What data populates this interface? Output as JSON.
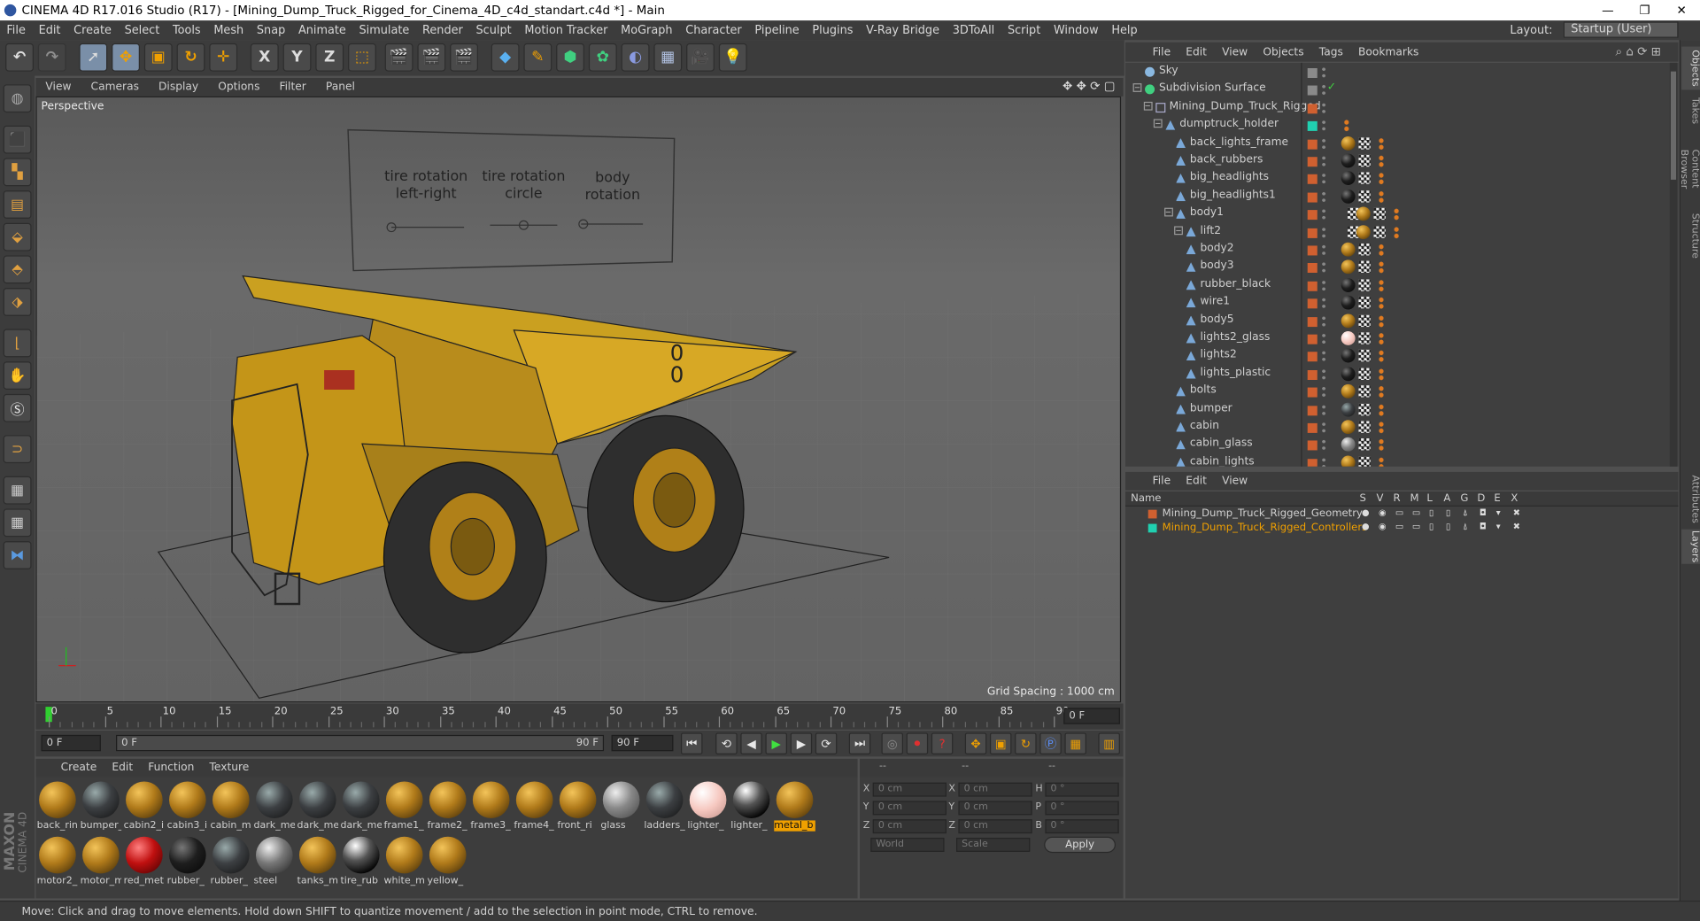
{
  "window": {
    "title": "CINEMA 4D R17.016 Studio (R17) - [Mining_Dump_Truck_Rigged_for_Cinema_4D_c4d_standart.c4d *] - Main",
    "controls": [
      "—",
      "❐",
      "✕"
    ]
  },
  "menu": [
    "File",
    "Edit",
    "Create",
    "Select",
    "Tools",
    "Mesh",
    "Snap",
    "Animate",
    "Simulate",
    "Render",
    "Sculpt",
    "Motion Tracker",
    "MoGraph",
    "Character",
    "Pipeline",
    "Plugins",
    "V-Ray Bridge",
    "3DToAll",
    "Script",
    "Window",
    "Help"
  ],
  "layout": {
    "label": "Layout:",
    "value": "Startup (User)"
  },
  "toolbar": {
    "axis": [
      "X",
      "Y",
      "Z"
    ]
  },
  "viewport": {
    "menu": [
      "View",
      "Cameras",
      "Display",
      "Options",
      "Filter",
      "Panel"
    ],
    "camera": "Perspective",
    "grid_spacing": "Grid Spacing : 1000 cm",
    "controls": [
      {
        "label": "tire rotation\nleft-right"
      },
      {
        "label": "tire rotation\ncircle"
      },
      {
        "label": "body\nrotation"
      }
    ],
    "truck_marks": "0\n0"
  },
  "timeline": {
    "ticks": [
      "0",
      "5",
      "10",
      "15",
      "20",
      "25",
      "30",
      "35",
      "40",
      "45",
      "50",
      "55",
      "60",
      "65",
      "70",
      "75",
      "80",
      "85",
      "90"
    ],
    "end_field": "0 F"
  },
  "transport": {
    "start": "0 F",
    "current": "0 F",
    "slider_end": "90 F",
    "end": "90 F"
  },
  "materials": {
    "menu": [
      "Create",
      "Edit",
      "Function",
      "Texture"
    ],
    "row1": [
      {
        "name": "back_rin",
        "type": "gold"
      },
      {
        "name": "bumper_",
        "type": "dark"
      },
      {
        "name": "cabin2_i",
        "type": "gold"
      },
      {
        "name": "cabin3_i",
        "type": "gold"
      },
      {
        "name": "cabin_m",
        "type": "gold"
      },
      {
        "name": "dark_me",
        "type": "dark"
      },
      {
        "name": "dark_me",
        "type": "dark"
      },
      {
        "name": "dark_me",
        "type": "dark"
      },
      {
        "name": "frame1_",
        "type": "gold"
      },
      {
        "name": "frame2_",
        "type": "gold"
      },
      {
        "name": "frame3_",
        "type": "gold"
      },
      {
        "name": "frame4_",
        "type": "gold"
      },
      {
        "name": "front_ri",
        "type": "gold"
      },
      {
        "name": "glass",
        "type": "glass"
      },
      {
        "name": "ladders_",
        "type": "dark"
      },
      {
        "name": "lighter_",
        "type": "pink"
      },
      {
        "name": "lighter_",
        "type": "chrome"
      },
      {
        "name": "metal_b",
        "type": "gold",
        "selected": true
      }
    ],
    "row2": [
      {
        "name": "motor2_",
        "type": "gold"
      },
      {
        "name": "motor_m",
        "type": "gold"
      },
      {
        "name": "red_met",
        "type": "red"
      },
      {
        "name": "rubber_",
        "type": "black"
      },
      {
        "name": "rubber_",
        "type": "dark"
      },
      {
        "name": "steel",
        "type": "steel"
      },
      {
        "name": "tanks_m",
        "type": "gold"
      },
      {
        "name": "tire_rub",
        "type": "chrome"
      },
      {
        "name": "white_m",
        "type": "gold"
      },
      {
        "name": "yellow_",
        "type": "gold"
      }
    ]
  },
  "coords": {
    "header": [
      "--",
      "--",
      "--"
    ],
    "rows": [
      {
        "a": "X",
        "av": "0 cm",
        "b": "X",
        "bv": "0 cm",
        "c": "H",
        "cv": "0 °"
      },
      {
        "a": "Y",
        "av": "0 cm",
        "b": "Y",
        "bv": "0 cm",
        "c": "P",
        "cv": "0 °"
      },
      {
        "a": "Z",
        "av": "0 cm",
        "b": "Z",
        "bv": "0 cm",
        "c": "B",
        "cv": "0 °"
      }
    ],
    "world": "World",
    "scale": "Scale",
    "apply": "Apply"
  },
  "status": "Move: Click and drag to move elements. Hold down SHIFT to quantize movement / add to the selection in point mode, CTRL to remove.",
  "objects": {
    "menu": [
      "File",
      "Edit",
      "View",
      "Objects",
      "Tags",
      "Bookmarks"
    ],
    "rows": [
      {
        "name": "Sky",
        "indent": 0,
        "kind": "sky"
      },
      {
        "name": "Subdivision Surface",
        "indent": 0,
        "kind": "subd"
      },
      {
        "name": "Mining_Dump_Truck_Rigged",
        "indent": 1,
        "kind": "null"
      },
      {
        "name": "dumptruck_holder",
        "indent": 2,
        "kind": "obj",
        "green": true
      },
      {
        "name": "back_lights_frame",
        "indent": 3,
        "kind": "obj",
        "mat": "gold"
      },
      {
        "name": "back_rubbers",
        "indent": 3,
        "kind": "obj",
        "mat": "black"
      },
      {
        "name": "big_headlights",
        "indent": 3,
        "kind": "obj",
        "mat": "black"
      },
      {
        "name": "big_headlights1",
        "indent": 3,
        "kind": "obj",
        "mat": "black"
      },
      {
        "name": "body1",
        "indent": 3,
        "kind": "obj",
        "mat": "gold"
      },
      {
        "name": "lift2",
        "indent": 4,
        "kind": "obj",
        "mat": "gold"
      },
      {
        "name": "body2",
        "indent": 4,
        "kind": "obj",
        "mat": "gold"
      },
      {
        "name": "body3",
        "indent": 4,
        "kind": "obj",
        "mat": "gold"
      },
      {
        "name": "rubber_black",
        "indent": 4,
        "kind": "obj",
        "mat": "black"
      },
      {
        "name": "wire1",
        "indent": 4,
        "kind": "obj",
        "mat": "black"
      },
      {
        "name": "body5",
        "indent": 4,
        "kind": "obj",
        "mat": "gold"
      },
      {
        "name": "lights2_glass",
        "indent": 4,
        "kind": "obj",
        "mat": "pink"
      },
      {
        "name": "lights2",
        "indent": 4,
        "kind": "obj",
        "mat": "black"
      },
      {
        "name": "lights_plastic",
        "indent": 4,
        "kind": "obj",
        "mat": "black"
      },
      {
        "name": "bolts",
        "indent": 3,
        "kind": "obj",
        "mat": "gold"
      },
      {
        "name": "bumper",
        "indent": 3,
        "kind": "obj",
        "mat": "dark"
      },
      {
        "name": "cabin",
        "indent": 3,
        "kind": "obj",
        "mat": "gold"
      },
      {
        "name": "cabin_glass",
        "indent": 3,
        "kind": "obj",
        "mat": "glass"
      },
      {
        "name": "cabin_lights",
        "indent": 3,
        "kind": "obj",
        "mat": "gold"
      }
    ]
  },
  "layers": {
    "menu": [
      "File",
      "Edit",
      "View"
    ],
    "columns": [
      "Name",
      "S",
      "V",
      "R",
      "M",
      "L",
      "A",
      "G",
      "D",
      "E",
      "X"
    ],
    "rows": [
      {
        "name": "Mining_Dump_Truck_Rigged_Geometry",
        "color": "#d06030",
        "active": false
      },
      {
        "name": "Mining_Dump_Truck_Rigged_Controllers",
        "color": "#20d0b0",
        "active": true
      }
    ]
  },
  "sidetabs": [
    "Objects",
    "Takes",
    "Content Browser",
    "Structure",
    "Attributes",
    "Layers"
  ]
}
